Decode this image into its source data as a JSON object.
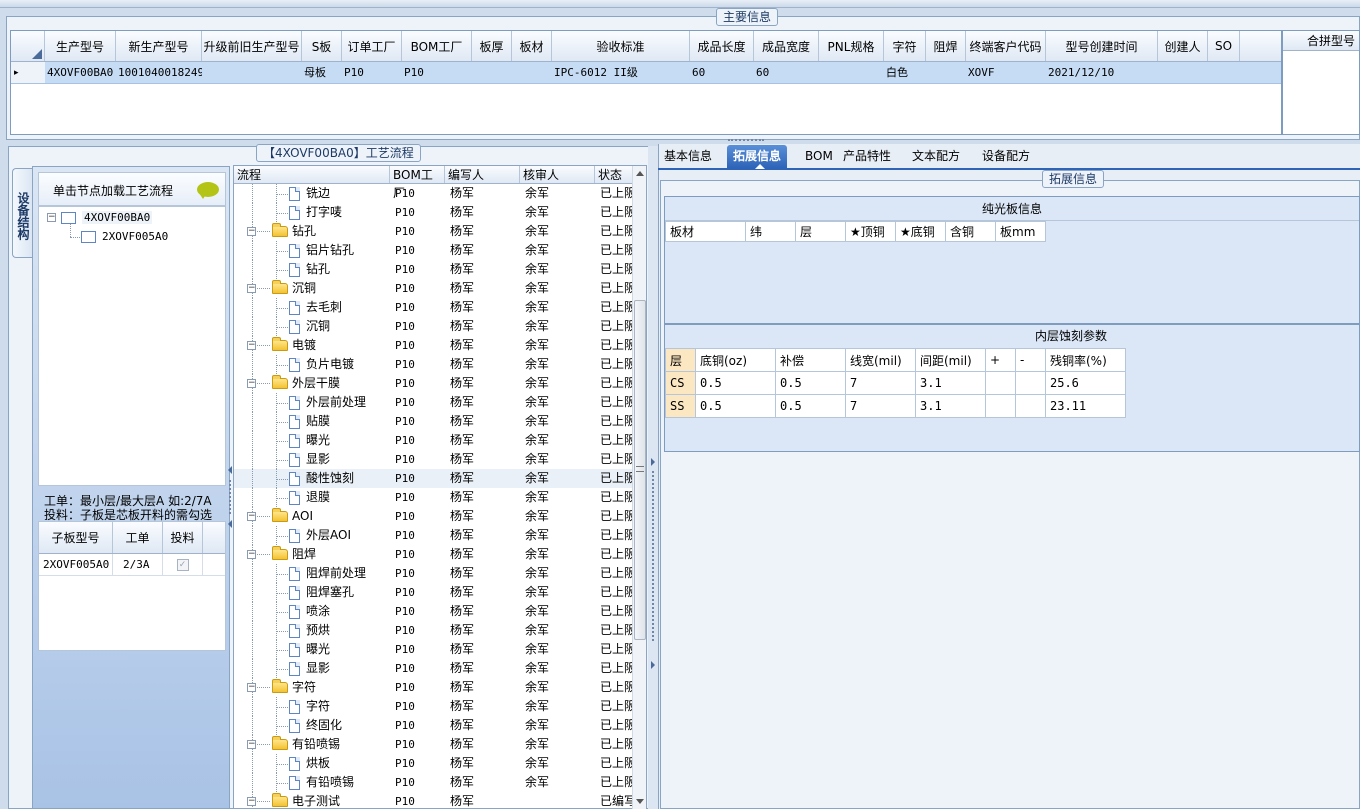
{
  "main_section_title": "主要信息",
  "merge_panel_title": "合拼型号",
  "main_grid": {
    "columns": [
      "生产型号",
      "新生产型号",
      "升级前旧生产型号",
      "S板",
      "订单工厂",
      "BOM工厂",
      "板厚",
      "板材",
      "验收标准",
      "成品长度",
      "成品宽度",
      "PNL规格",
      "字符",
      "阻焊",
      "终端客户代码",
      "型号创建时间",
      "创建人",
      "SO"
    ],
    "row": [
      "4XOVF00BA0",
      "10010400182497",
      "",
      "母板",
      "P10",
      "P10",
      "",
      "",
      "IPC-6012 II级",
      "60",
      "60",
      "",
      "白色",
      "",
      "XOVF",
      "2021/12/10",
      "",
      ""
    ],
    "row_marker": "▸"
  },
  "left_panel": {
    "vertical_tab": "设备结构",
    "hint": "单击节点加载工艺流程",
    "tree": [
      {
        "label": "4XOVF00BA0"
      },
      {
        "label": "2XOVF005A0"
      }
    ],
    "note1": "工单：最小层/最大层A 如:2/7A",
    "note2": "投料：子板是芯板开料的需勾选",
    "sub_columns": [
      "子板型号",
      "工单",
      "投料"
    ],
    "sub_rows": [
      {
        "model": "2XOVF005A0",
        "order": "2/3A",
        "check": "✓"
      }
    ]
  },
  "process_panel": {
    "title": "【4XOVF00BA0】工艺流程",
    "columns": [
      "流程",
      "BOM工厂",
      "编写人",
      "核审人",
      "状态"
    ],
    "expand_symbol": "−",
    "rows": [
      {
        "type": "child",
        "name": "铣边",
        "factory": "P10",
        "writer": "杨军",
        "reviewer": "余军",
        "status": "已上阪"
      },
      {
        "type": "child",
        "name": "打字唛",
        "factory": "P10",
        "writer": "杨军",
        "reviewer": "余军",
        "status": "已上阪"
      },
      {
        "type": "group",
        "name": "钻孔",
        "factory": "P10",
        "writer": "杨军",
        "reviewer": "余军",
        "status": "已上阪"
      },
      {
        "type": "child",
        "name": "铝片钻孔",
        "factory": "P10",
        "writer": "杨军",
        "reviewer": "余军",
        "status": "已上阪"
      },
      {
        "type": "child",
        "name": "钻孔",
        "factory": "P10",
        "writer": "杨军",
        "reviewer": "余军",
        "status": "已上阪"
      },
      {
        "type": "group",
        "name": "沉铜",
        "factory": "P10",
        "writer": "杨军",
        "reviewer": "余军",
        "status": "已上阪"
      },
      {
        "type": "child",
        "name": "去毛刺",
        "factory": "P10",
        "writer": "杨军",
        "reviewer": "余军",
        "status": "已上阪"
      },
      {
        "type": "child",
        "name": "沉铜",
        "factory": "P10",
        "writer": "杨军",
        "reviewer": "余军",
        "status": "已上阪"
      },
      {
        "type": "group",
        "name": "电镀",
        "factory": "P10",
        "writer": "杨军",
        "reviewer": "余军",
        "status": "已上阪"
      },
      {
        "type": "child",
        "name": "负片电镀",
        "factory": "P10",
        "writer": "杨军",
        "reviewer": "余军",
        "status": "已上阪"
      },
      {
        "type": "group",
        "name": "外层干膜",
        "factory": "P10",
        "writer": "杨军",
        "reviewer": "余军",
        "status": "已上阪"
      },
      {
        "type": "child",
        "name": "外层前处理",
        "factory": "P10",
        "writer": "杨军",
        "reviewer": "余军",
        "status": "已上阪"
      },
      {
        "type": "child",
        "name": "贴膜",
        "factory": "P10",
        "writer": "杨军",
        "reviewer": "余军",
        "status": "已上阪"
      },
      {
        "type": "child",
        "name": "曝光",
        "factory": "P10",
        "writer": "杨军",
        "reviewer": "余军",
        "status": "已上阪"
      },
      {
        "type": "child",
        "name": "显影",
        "factory": "P10",
        "writer": "杨军",
        "reviewer": "余军",
        "status": "已上阪"
      },
      {
        "type": "child",
        "name": "酸性蚀刻",
        "factory": "P10",
        "writer": "杨军",
        "reviewer": "余军",
        "status": "已上阪",
        "selected": true
      },
      {
        "type": "child",
        "name": "退膜",
        "factory": "P10",
        "writer": "杨军",
        "reviewer": "余军",
        "status": "已上阪"
      },
      {
        "type": "group",
        "name": "AOI",
        "factory": "P10",
        "writer": "杨军",
        "reviewer": "余军",
        "status": "已上阪"
      },
      {
        "type": "child",
        "name": "外层AOI",
        "factory": "P10",
        "writer": "杨军",
        "reviewer": "余军",
        "status": "已上阪"
      },
      {
        "type": "group",
        "name": "阻焊",
        "factory": "P10",
        "writer": "杨军",
        "reviewer": "余军",
        "status": "已上阪"
      },
      {
        "type": "child",
        "name": "阻焊前处理",
        "factory": "P10",
        "writer": "杨军",
        "reviewer": "余军",
        "status": "已上阪"
      },
      {
        "type": "child",
        "name": "阻焊塞孔",
        "factory": "P10",
        "writer": "杨军",
        "reviewer": "余军",
        "status": "已上阪"
      },
      {
        "type": "child",
        "name": "喷涂",
        "factory": "P10",
        "writer": "杨军",
        "reviewer": "余军",
        "status": "已上阪"
      },
      {
        "type": "child",
        "name": "预烘",
        "factory": "P10",
        "writer": "杨军",
        "reviewer": "余军",
        "status": "已上阪"
      },
      {
        "type": "child",
        "name": "曝光",
        "factory": "P10",
        "writer": "杨军",
        "reviewer": "余军",
        "status": "已上阪"
      },
      {
        "type": "child",
        "name": "显影",
        "factory": "P10",
        "writer": "杨军",
        "reviewer": "余军",
        "status": "已上阪"
      },
      {
        "type": "group",
        "name": "字符",
        "factory": "P10",
        "writer": "杨军",
        "reviewer": "余军",
        "status": "已上阪"
      },
      {
        "type": "child",
        "name": "字符",
        "factory": "P10",
        "writer": "杨军",
        "reviewer": "余军",
        "status": "已上阪"
      },
      {
        "type": "child",
        "name": "终固化",
        "factory": "P10",
        "writer": "杨军",
        "reviewer": "余军",
        "status": "已上阪"
      },
      {
        "type": "group",
        "name": "有铅喷锡",
        "factory": "P10",
        "writer": "杨军",
        "reviewer": "余军",
        "status": "已上阪"
      },
      {
        "type": "child",
        "name": "烘板",
        "factory": "P10",
        "writer": "杨军",
        "reviewer": "余军",
        "status": "已上阪"
      },
      {
        "type": "child",
        "name": "有铅喷锡",
        "factory": "P10",
        "writer": "杨军",
        "reviewer": "余军",
        "status": "已上阪"
      },
      {
        "type": "group",
        "name": "电子测试",
        "factory": "P10",
        "writer": "杨军",
        "reviewer": "",
        "status": "已编写"
      }
    ]
  },
  "right_panel": {
    "tabs": [
      {
        "label": "基本信息",
        "active": false
      },
      {
        "label": "拓展信息",
        "active": true
      },
      {
        "label": "BOM",
        "active": false
      },
      {
        "label": "产品特性",
        "active": false
      },
      {
        "label": "文本配方",
        "active": false
      },
      {
        "label": "设备配方",
        "active": false
      }
    ],
    "section_title": "拓展信息",
    "plain_board": {
      "title": "纯光板信息",
      "columns": [
        "板材",
        "纬",
        "层",
        "★顶铜",
        "★底铜",
        "含铜",
        "板mm"
      ]
    },
    "inner_etch": {
      "title": "内层蚀刻参数",
      "columns": [
        "层",
        "底铜(oz)",
        "补偿",
        "线宽(mil)",
        "间距(mil)",
        "+",
        "-",
        "残铜率(%)"
      ],
      "rows": [
        [
          "CS",
          "0.5",
          "0.5",
          "7",
          "3.1",
          "",
          "",
          "25.6"
        ],
        [
          "SS",
          "0.5",
          "0.5",
          "7",
          "3.1",
          "",
          "",
          "23.11"
        ]
      ]
    }
  },
  "colors": {
    "accent": "#2e64b8",
    "header_bg": "#dfe8f4",
    "selection": "#c6dcf5",
    "layer_cell": "#fbe7c2"
  }
}
